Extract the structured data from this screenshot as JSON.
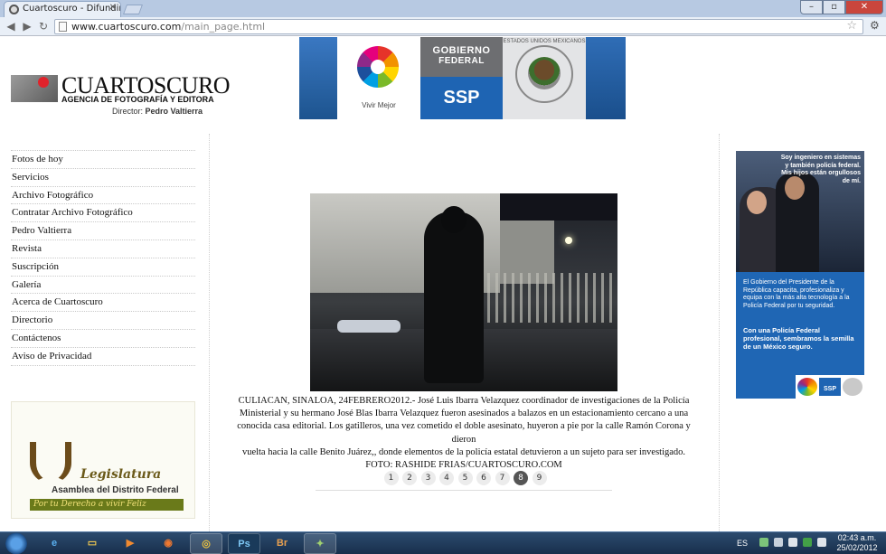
{
  "browser": {
    "tab_title": "Cuartoscuro - Difundir la in",
    "url_domain": "www.cuartoscuro.com",
    "url_path": "/main_page.html"
  },
  "header": {
    "logo_name": "CUARTOSCURO",
    "logo_subtitle": "AGENCIA DE FOTOGRAFÍA Y EDITORA",
    "director_label": "Director:",
    "director_name": "Pedro Valtierra"
  },
  "banner": {
    "vivir_mejor": "Vivir Mejor",
    "gobierno": "GOBIERNO",
    "federal": "FEDERAL",
    "ssp": "SSP",
    "seal_text": "ESTADOS UNIDOS MEXICANOS"
  },
  "sidebar": {
    "items": [
      {
        "label": "Fotos de hoy"
      },
      {
        "label": "Servicios"
      },
      {
        "label": "Archivo Fotográfico"
      },
      {
        "label": "Contratar Archivo Fotográfico"
      },
      {
        "label": "Pedro Valtierra"
      },
      {
        "label": "Revista"
      },
      {
        "label": "Suscripción"
      },
      {
        "label": "Galería"
      },
      {
        "label": "Acerca de Cuartoscuro"
      },
      {
        "label": "Directorio"
      },
      {
        "label": "Contáctenos"
      },
      {
        "label": "Aviso de Privacidad"
      }
    ],
    "ad": {
      "title": "Legislatura",
      "subtitle": "Asamblea del Distrito Federal",
      "slogan": "Por tu Derecho a vivir Feliz"
    }
  },
  "main": {
    "caption_lines": [
      "CULIACAN, SINALOA, 24FEBRERO2012.- José Luis Ibarra Velazquez coordinador de investigaciones de la Policía",
      "Ministerial y su hermano José Blas Ibarra Velazquez fueron asesinados a balazos en un estacionamiento cercano a una",
      "conocida casa editorial. Los gatilleros, una vez cometido el doble asesinato, huyeron a pie por la calle Ramón Corona y dieron",
      "vuelta hacia la calle Benito Juárez,, donde elementos de la policía estatal detuvieron a un sujeto para ser investigado.",
      "FOTO: RASHIDE FRIAS/CUARTOSCURO.COM"
    ],
    "pages": [
      "1",
      "2",
      "3",
      "4",
      "5",
      "6",
      "7",
      "8",
      "9"
    ],
    "active_page": "8"
  },
  "right_ad": {
    "quote": "Soy ingeniero en sistemas y también policía federal. Mis hijos están orgullosos de mí.",
    "text1": "El Gobierno del Presidente de la República capacita, profesionaliza y equipa con la más alta tecnología a la Policía Federal por tu seguridad.",
    "text2": "Con una Policía Federal profesional, sembramos la semilla de un México seguro."
  },
  "taskbar": {
    "lang": "ES",
    "time": "02:43 a.m.",
    "date": "25/02/2012",
    "apps": [
      "ie",
      "explorer",
      "media-player",
      "firefox",
      "chrome",
      "photoshop",
      "bridge",
      "network"
    ]
  }
}
